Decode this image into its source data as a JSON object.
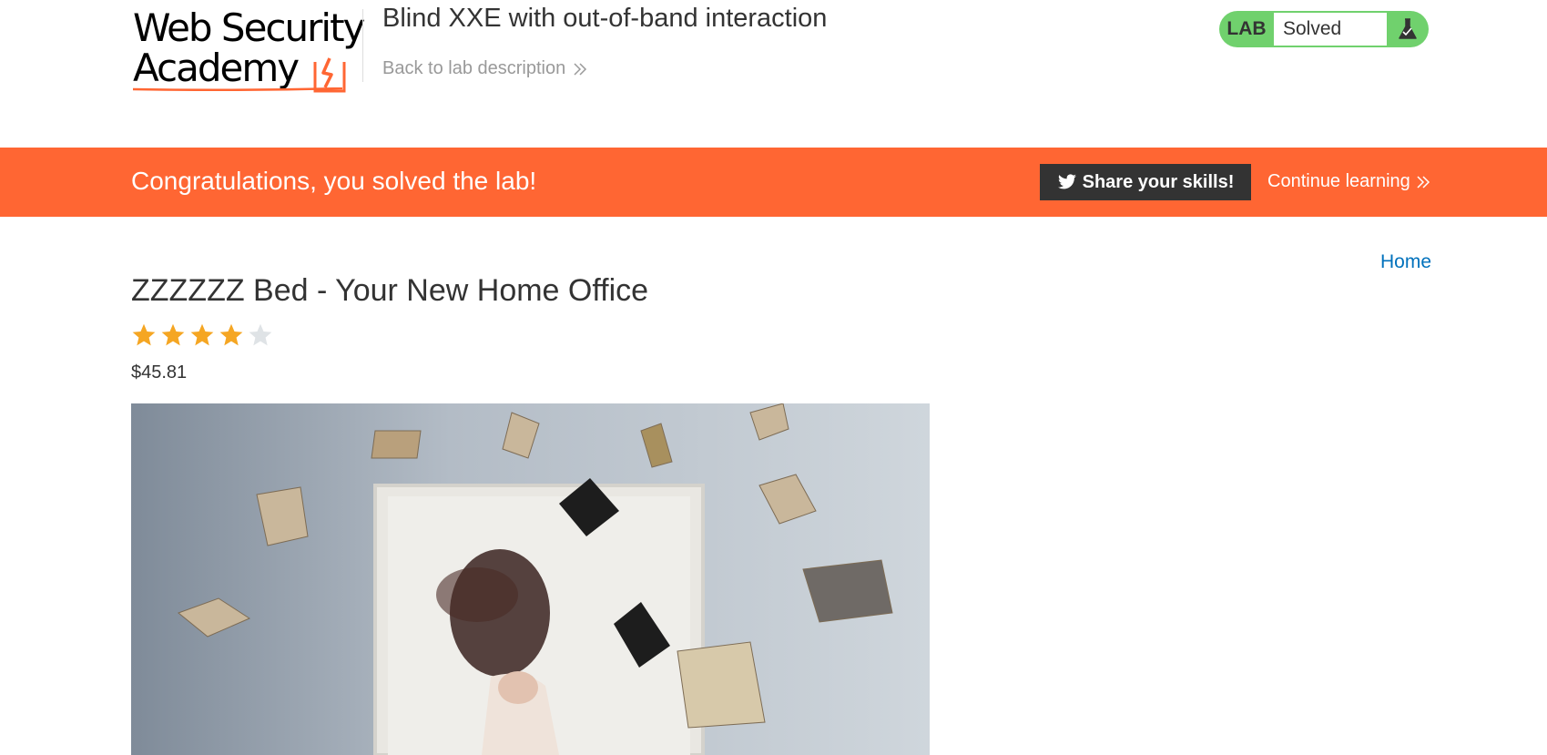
{
  "header": {
    "logo_line1": "Web Security",
    "logo_line2": "Academy",
    "lab_title": "Blind XXE with out-of-band interaction",
    "back_link": "Back to lab description",
    "lab_tag": "LAB",
    "lab_status": "Solved",
    "lab_flask_icon": "flask-icon"
  },
  "banner": {
    "message": "Congratulations, you solved the lab!",
    "share_label": "Share your skills!",
    "share_icon": "twitter-icon",
    "continue_label": "Continue learning"
  },
  "nav": {
    "home": "Home"
  },
  "product": {
    "title": "ZZZZZZ Bed - Your New Home Office",
    "rating": 4,
    "rating_max": 5,
    "price": "$45.81",
    "image_alt": "woman lying on a bed surrounded by flying books"
  },
  "colors": {
    "brand_orange": "#ff6633",
    "lab_green": "#70d16d",
    "star_filled": "#f5a623",
    "star_empty": "#dfe3e6",
    "link_blue": "#0071bc"
  }
}
